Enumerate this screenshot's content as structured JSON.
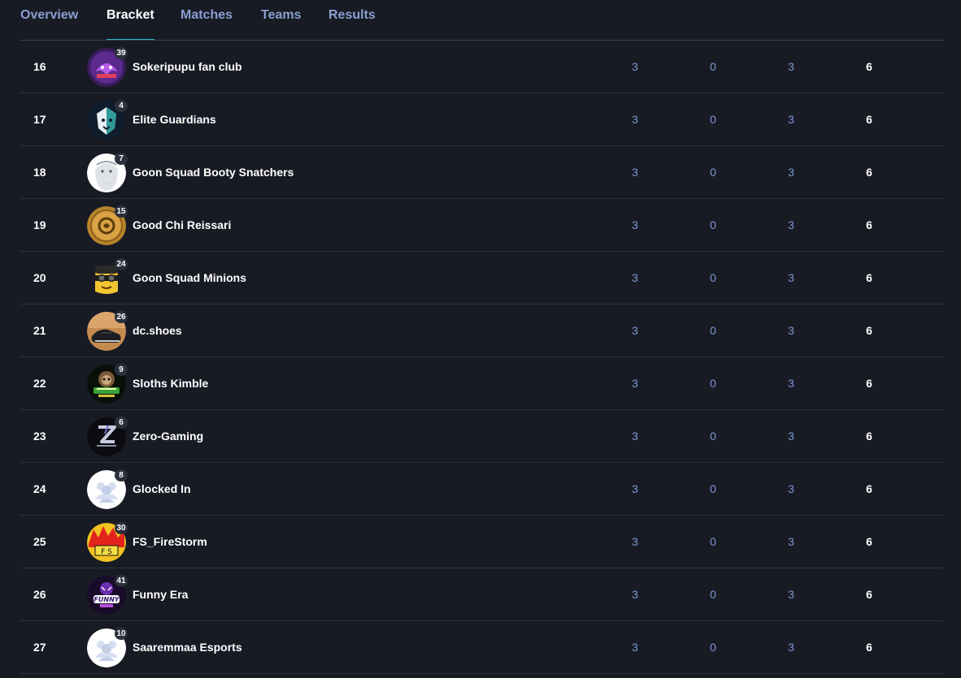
{
  "tabs": [
    "Overview",
    "Bracket",
    "Matches",
    "Teams",
    "Results"
  ],
  "active_tab": "Bracket",
  "rows": [
    {
      "rank": "16",
      "seed": "39",
      "name": "Sokeripupu fan club",
      "avatar": "purple-tiger-logo",
      "w": "3",
      "l": "0",
      "m": "3",
      "pts": "6"
    },
    {
      "rank": "17",
      "seed": "4",
      "name": "Elite Guardians",
      "avatar": "lion-logo",
      "w": "3",
      "l": "0",
      "m": "3",
      "pts": "6"
    },
    {
      "rank": "18",
      "seed": "7",
      "name": "Goon Squad Booty Snatchers",
      "avatar": "old-man-logo",
      "w": "3",
      "l": "0",
      "m": "3",
      "pts": "6"
    },
    {
      "rank": "19",
      "seed": "15",
      "name": "Good Chi Reissari",
      "avatar": "gold-coin-logo",
      "w": "3",
      "l": "0",
      "m": "3",
      "pts": "6"
    },
    {
      "rank": "20",
      "seed": "24",
      "name": "Goon Squad Minions",
      "avatar": "minion-logo",
      "w": "3",
      "l": "0",
      "m": "3",
      "pts": "6"
    },
    {
      "rank": "21",
      "seed": "26",
      "name": "dc.shoes",
      "avatar": "shoe-photo",
      "w": "3",
      "l": "0",
      "m": "3",
      "pts": "6"
    },
    {
      "rank": "22",
      "seed": "9",
      "name": "Sloths Kimble",
      "avatar": "sloth-logo",
      "w": "3",
      "l": "0",
      "m": "3",
      "pts": "6"
    },
    {
      "rank": "23",
      "seed": "6",
      "name": "Zero-Gaming",
      "avatar": "zero-logo",
      "w": "3",
      "l": "0",
      "m": "3",
      "pts": "6"
    },
    {
      "rank": "24",
      "seed": "8",
      "name": "Glocked In",
      "avatar": "default-team-icon",
      "w": "3",
      "l": "0",
      "m": "3",
      "pts": "6"
    },
    {
      "rank": "25",
      "seed": "30",
      "name": "FS_FireStorm",
      "avatar": "fire-logo",
      "w": "3",
      "l": "0",
      "m": "3",
      "pts": "6"
    },
    {
      "rank": "26",
      "seed": "41",
      "name": "Funny Era",
      "avatar": "funny-era-logo",
      "w": "3",
      "l": "0",
      "m": "3",
      "pts": "6"
    },
    {
      "rank": "27",
      "seed": "10",
      "name": "Saaremmaa Esports",
      "avatar": "default-team-icon",
      "w": "3",
      "l": "0",
      "m": "3",
      "pts": "6"
    }
  ],
  "colors": {
    "background": "#181b24",
    "tab_inactive": "#8a9fd0",
    "tab_underline": "#2fb3c9",
    "stat_blue": "#7d99d4",
    "row_divider": "#2d323e"
  }
}
